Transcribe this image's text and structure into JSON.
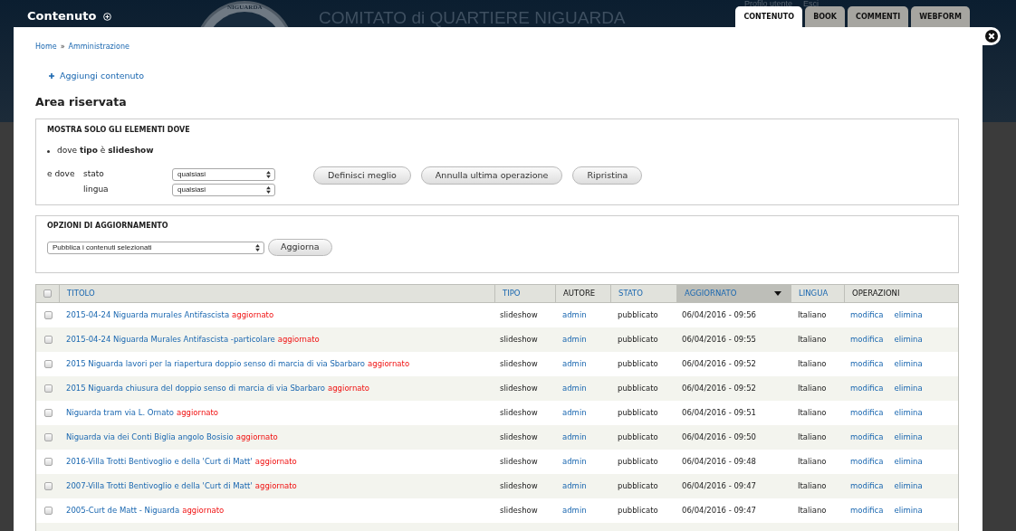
{
  "background": {
    "logo_text": "NIGUARDA",
    "site_name": "COMITATO di QUARTIERE NIGUARDA",
    "user_links": [
      "Profilo utente",
      "Esci"
    ]
  },
  "overlay": {
    "title": "Contenuto",
    "tabs": [
      {
        "label": "CONTENUTO",
        "selected": true
      },
      {
        "label": "BOOK",
        "selected": false
      },
      {
        "label": "COMMENTI",
        "selected": false
      },
      {
        "label": "WEBFORM",
        "selected": false
      }
    ]
  },
  "breadcrumb": {
    "items": [
      "Home",
      "Amministrazione"
    ],
    "separator": "»"
  },
  "action_link": "Aggiungi contenuto",
  "page_title": "Area riservata",
  "filter": {
    "legend": "MOSTRA SOLO GLI ELEMENTI DOVE",
    "active_filters": [
      "dove **tipo** è **slideshow**"
    ],
    "conjunction": "e dove",
    "fields": [
      {
        "label": "stato",
        "value": "qualsiasi"
      },
      {
        "label": "lingua",
        "value": "qualsiasi"
      }
    ],
    "buttons": [
      "Definisci meglio",
      "Annulla ultima operazione",
      "Ripristina"
    ]
  },
  "update_options": {
    "legend": "OPZIONI DI AGGIORNAMENTO",
    "action": "Pubblica i contenuti selezionati",
    "button": "Aggiorna"
  },
  "table": {
    "select_all_checked": false,
    "columns": [
      {
        "label": "TITOLO",
        "sortable": true,
        "sorted": false
      },
      {
        "label": "TIPO",
        "sortable": true,
        "sorted": false
      },
      {
        "label": "AUTORE",
        "sortable": false,
        "sorted": false
      },
      {
        "label": "STATO",
        "sortable": true,
        "sorted": false
      },
      {
        "label": "AGGIORNATO",
        "sortable": true,
        "sorted": true
      },
      {
        "label": "LINGUA",
        "sortable": true,
        "sorted": false
      },
      {
        "label": "OPERAZIONI",
        "sortable": false,
        "sorted": false
      }
    ],
    "rows": [
      {
        "checked": false,
        "title": "2015-04-24 Niguarda murales Antifascista",
        "marker": "aggiornato",
        "type": "slideshow",
        "author": "admin",
        "status": "pubblicato",
        "updated": "06/04/2016 - 09:56",
        "language": "Italiano",
        "operations": [
          "modifica",
          "elimina"
        ]
      },
      {
        "checked": false,
        "title": "2015-04-24 Niguarda Murales Antifascista -particolare",
        "marker": "aggiornato",
        "type": "slideshow",
        "author": "admin",
        "status": "pubblicato",
        "updated": "06/04/2016 - 09:55",
        "language": "Italiano",
        "operations": [
          "modifica",
          "elimina"
        ]
      },
      {
        "checked": false,
        "title": "2015 Niguarda lavori per la riapertura doppio senso di marcia di via Sbarbaro",
        "marker": "aggiornato",
        "type": "slideshow",
        "author": "admin",
        "status": "pubblicato",
        "updated": "06/04/2016 - 09:52",
        "language": "Italiano",
        "operations": [
          "modifica",
          "elimina"
        ]
      },
      {
        "checked": false,
        "title": "2015 Niguarda chiusura del doppio senso di marcia di via Sbarbaro",
        "marker": "aggiornato",
        "type": "slideshow",
        "author": "admin",
        "status": "pubblicato",
        "updated": "06/04/2016 - 09:52",
        "language": "Italiano",
        "operations": [
          "modifica",
          "elimina"
        ]
      },
      {
        "checked": false,
        "title": "Niguarda tram via L. Ornato",
        "marker": "aggiornato",
        "type": "slideshow",
        "author": "admin",
        "status": "pubblicato",
        "updated": "06/04/2016 - 09:51",
        "language": "Italiano",
        "operations": [
          "modifica",
          "elimina"
        ]
      },
      {
        "checked": false,
        "title": "Niguarda via dei Conti Biglia angolo Bosisio",
        "marker": "aggiornato",
        "type": "slideshow",
        "author": "admin",
        "status": "pubblicato",
        "updated": "06/04/2016 - 09:50",
        "language": "Italiano",
        "operations": [
          "modifica",
          "elimina"
        ]
      },
      {
        "checked": false,
        "title": "2016-Villa Trotti Bentivoglio e della 'Curt di Matt'",
        "marker": "aggiornato",
        "type": "slideshow",
        "author": "admin",
        "status": "pubblicato",
        "updated": "06/04/2016 - 09:48",
        "language": "Italiano",
        "operations": [
          "modifica",
          "elimina"
        ]
      },
      {
        "checked": false,
        "title": "2007-Villa Trotti Bentivoglio e della 'Curt di Matt'",
        "marker": "aggiornato",
        "type": "slideshow",
        "author": "admin",
        "status": "pubblicato",
        "updated": "06/04/2016 - 09:47",
        "language": "Italiano",
        "operations": [
          "modifica",
          "elimina"
        ]
      },
      {
        "checked": false,
        "title": "2005-Curt de Matt - Niguarda",
        "marker": "aggiornato",
        "type": "slideshow",
        "author": "admin",
        "status": "pubblicato",
        "updated": "06/04/2016 - 09:47",
        "language": "Italiano",
        "operations": [
          "modifica",
          "elimina"
        ]
      }
    ]
  }
}
